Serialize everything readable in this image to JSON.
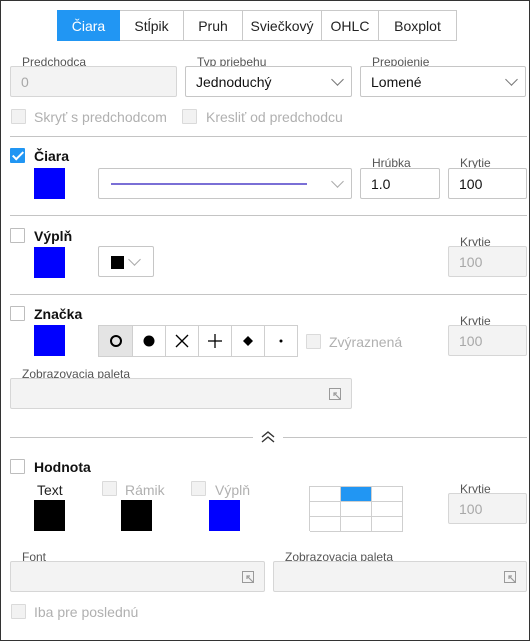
{
  "tabs": [
    {
      "label": "Čiara",
      "active": true
    },
    {
      "label": "Stĺpik",
      "active": false
    },
    {
      "label": "Pruh",
      "active": false
    },
    {
      "label": "Sviečkový",
      "active": false
    },
    {
      "label": "OHLC",
      "active": false
    },
    {
      "label": "Boxplot",
      "active": false
    }
  ],
  "top": {
    "predchodca_label": "Predchodca",
    "predchodca_value": "0",
    "typ_label": "Typ priebehu",
    "typ_value": "Jednoduchý",
    "prepojenie_label": "Prepojenie",
    "prepojenie_value": "Lomené",
    "skryt_label": "Skryť s predchodcom",
    "kreslit_label": "Kresliť od predchodcu"
  },
  "ciara": {
    "title": "Čiara",
    "checked": true,
    "color": "#0000ff",
    "line_color": "#7a6fd6",
    "hrubka_label": "Hrúbka",
    "hrubka_value": "1.0",
    "krytie_label": "Krytie",
    "krytie_value": "100"
  },
  "vypln": {
    "title": "Výplň",
    "checked": false,
    "color": "#0000ff",
    "pattern_color": "#000000",
    "krytie_label": "Krytie",
    "krytie_value": "100"
  },
  "znacka": {
    "title": "Značka",
    "checked": false,
    "color": "#0000ff",
    "markers": [
      "circle-open-icon",
      "circle-filled-icon",
      "x-cross-icon",
      "plus-icon",
      "diamond-icon",
      "dot-icon"
    ],
    "zvyraznena_label": "Zvýraznená",
    "krytie_label": "Krytie",
    "krytie_value": "100",
    "paleta_label": "Zobrazovacia paleta",
    "paleta_value": ""
  },
  "hodnota": {
    "title": "Hodnota",
    "checked": false,
    "text_label": "Text",
    "text_color": "#000000",
    "ramik_label": "Rámik",
    "ramik_color": "#000000",
    "vypln_label": "Výplň",
    "vypln_color": "#0000ff",
    "krytie_label": "Krytie",
    "krytie_value": "100",
    "position_selected": 1
  },
  "bottom": {
    "font_label": "Font",
    "font_value": "",
    "paleta_label": "Zobrazovacia paleta",
    "paleta_value": "",
    "iba_label": "Iba pre poslednú"
  },
  "colors": {
    "accent": "#2196f3",
    "blue_swatch": "#0000ff"
  }
}
